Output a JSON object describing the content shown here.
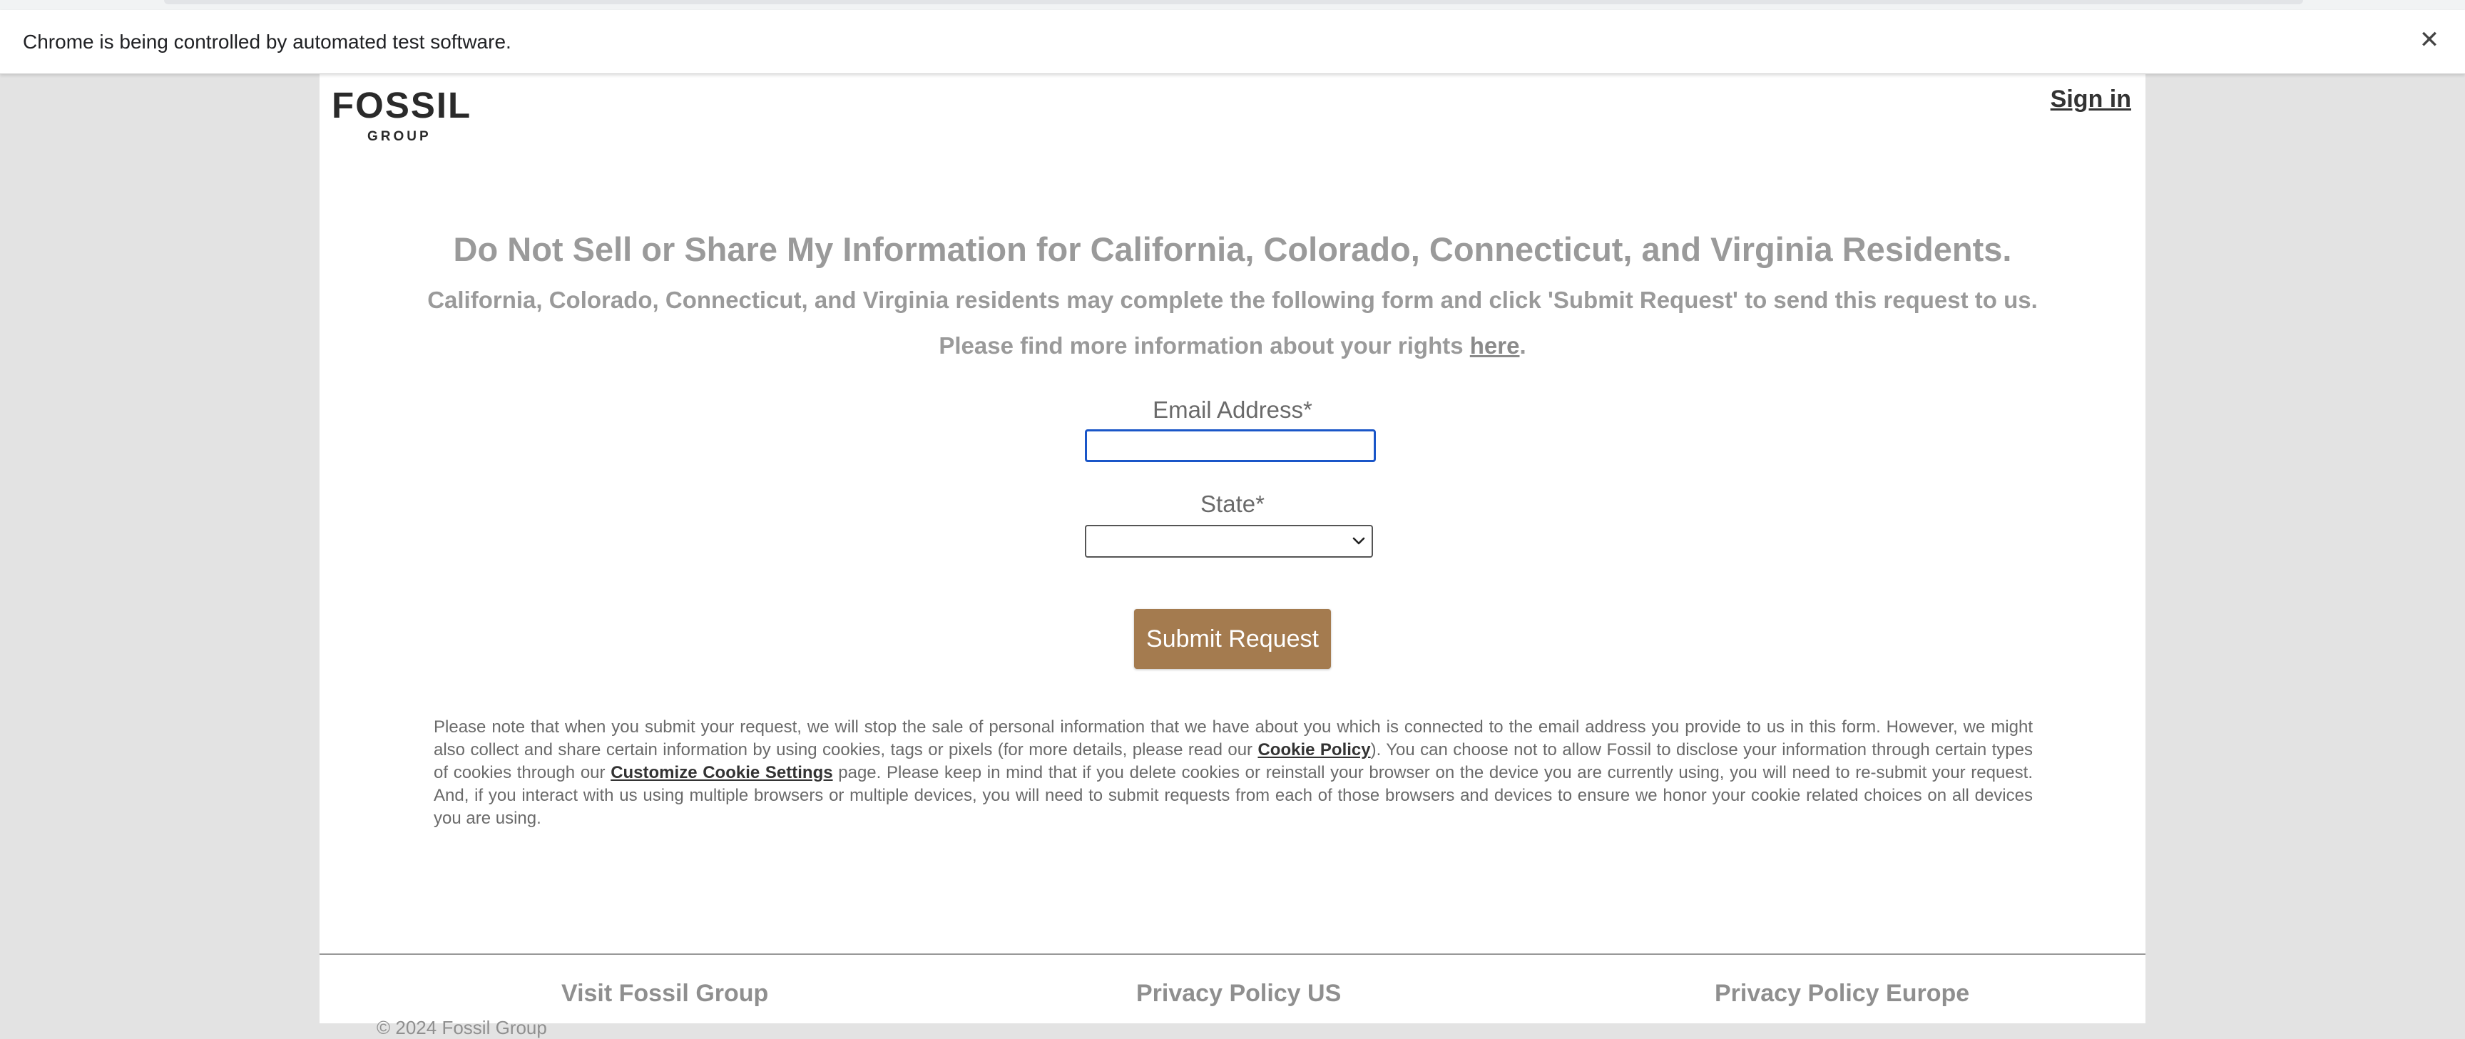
{
  "infobar": {
    "message": "Chrome is being controlled by automated test software.",
    "close_glyph": "✕"
  },
  "header": {
    "logo_text": "FOSSIL",
    "logo_subtext": "GROUP",
    "sign_in_label": "Sign in"
  },
  "main": {
    "title": "Do Not Sell or Share My Information for California, Colorado, Connecticut, and Virginia Residents.",
    "subtitle": "California, Colorado, Connecticut, and Virginia residents may complete the following form and click 'Submit Request' to send this request to us.",
    "rights_prefix": "Please find more information about your rights ",
    "rights_link": "here",
    "rights_suffix": "."
  },
  "form": {
    "email_label": "Email Address*",
    "email_value": "",
    "state_label": "State*",
    "state_value": "",
    "submit_label": "Submit Request"
  },
  "notice": {
    "part1": "Please note that when you submit your request, we will stop the sale of personal information that we have about you which is connected to the email address you provide to us in this form. However, we might also collect and share certain information by using cookies, tags or pixels (for more details, please read our ",
    "cookie_policy_link": "Cookie Policy",
    "part2": "). You can choose not to allow Fossil to disclose your information through certain types of cookies through our ",
    "cookie_settings_link": "Customize Cookie Settings",
    "part3": " page. Please keep in mind that if you delete cookies or reinstall your browser on the device you are currently using, you will need to re-submit your request. And, if you interact with us using multiple browsers or multiple devices, you will need to submit requests from each of those browsers and devices to ensure we honor your cookie related choices on all devices you are using."
  },
  "footer": {
    "link_visit": "Visit Fossil Group",
    "link_privacy_us": "Privacy Policy US",
    "link_privacy_europe": "Privacy Policy Europe",
    "copyright": "© 2024 Fossil Group"
  },
  "icons": {
    "select_chevron": "chevron-down-icon",
    "close": "close-icon"
  },
  "colors": {
    "submit_button": "#a47b4f",
    "focus_border": "#1a56c8",
    "heading_text": "#9a9a9a"
  }
}
